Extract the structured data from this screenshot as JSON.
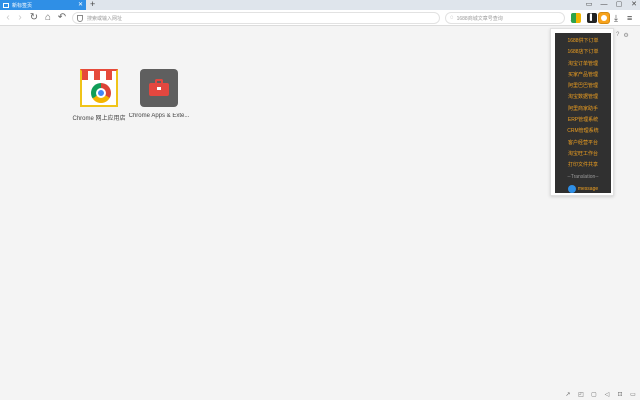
{
  "tabs": [
    {
      "title": "新标签页",
      "active": true
    }
  ],
  "new_tab_glyph": "+",
  "window_controls": [
    "▭",
    "—",
    "▢",
    "✕"
  ],
  "toolbar": {
    "back": "‹",
    "forward": "›",
    "reload": "↻",
    "home": "⌂",
    "undo": "↶",
    "address_placeholder": "搜索或输入网址",
    "search_placeholder": "1688商城文章号查询",
    "search_icon": "⌕",
    "dark_ext_label": "▌"
  },
  "shortcuts": [
    {
      "label": "Chrome 网上应用店",
      "icon": "chrome-web-store-icon"
    },
    {
      "label": "Chrome Apps & Exte...",
      "icon": "toolbox-icon"
    }
  ],
  "popup_menu": {
    "items": [
      "1688供下订单",
      "1688店下订单",
      "淘宝订单管理",
      "买家产品管理",
      "阿里巴巴管理",
      "淘宝数据管理",
      "阿里商家助手",
      "ERP管理系统",
      "CRM管理系统",
      "客户经营平台",
      "淘宝旺工作台",
      "打印文件共享"
    ],
    "translation": "--Translation--",
    "message": "message"
  },
  "side_glyphs": [
    "?",
    "⚙"
  ],
  "status_glyphs": [
    "↗",
    "◰",
    "▢",
    "◁",
    "⊡",
    "▭"
  ],
  "colors": {
    "accent": "#2f8fe6",
    "menu_text": "#f0a020",
    "menu_bg": "#303030"
  }
}
